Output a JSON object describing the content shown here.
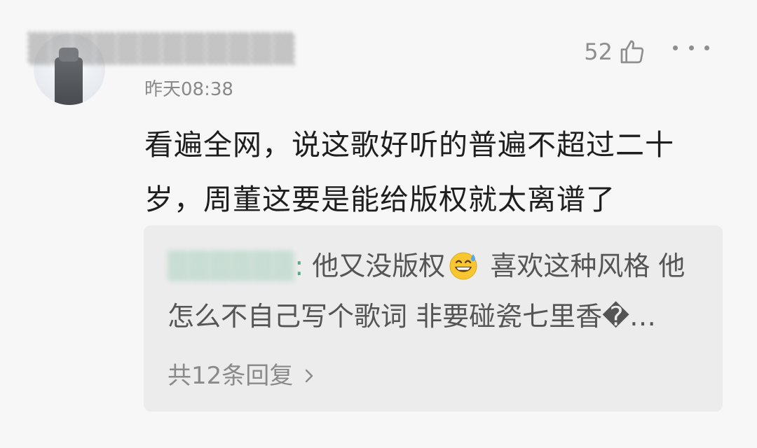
{
  "comment": {
    "author_name": "▒▒▒▒▒▒▒▒▒▒▒▒",
    "timestamp": "昨天08:38",
    "like_count": "52",
    "text": "看遍全网，说这歌好听的普遍不超过二十岁，周董这要是能给版权就太离谱了"
  },
  "reply_preview": {
    "author_name": "▒▒▒▒▒▒",
    "colon": ":",
    "text_before_emoji": "他又没版权",
    "emoji": "grinning-face-with-sweat-icon",
    "text_after_emoji": " 喜欢这种风格 他怎么不自己写个歌词 非要碰瓷七里香�…",
    "reply_count_label": "共12条回复"
  },
  "icons": {
    "like": "thumbs-up-icon",
    "more": "more-dots-icon",
    "chevron": "chevron-right-icon"
  },
  "colors": {
    "background": "#f7f7f7",
    "reply_box": "#ececec",
    "accent_green": "#5aa986",
    "muted_text": "#8a8a8a"
  }
}
